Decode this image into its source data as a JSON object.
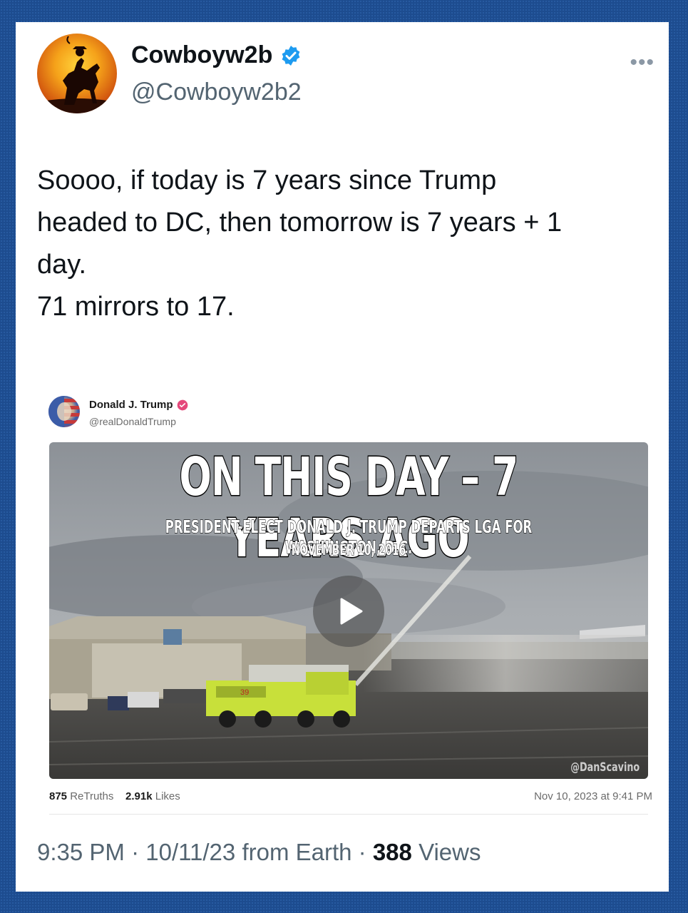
{
  "tweet": {
    "display_name": "Cowboyw2b",
    "handle": "@Cowboyw2b2",
    "more_label": "•••",
    "text_lines": [
      "Soooo, if today is 7 years since Trump",
      "headed to DC, then tomorrow is 7 years + 1",
      "day.",
      "71 mirrors to 17."
    ],
    "time": "9:35 PM",
    "date": "10/11/23",
    "source": "from Earth",
    "views_count": "388",
    "views_label": "Views",
    "separator": "·"
  },
  "embedded_post": {
    "display_name": "Donald J. Trump",
    "handle": "@realDonaldTrump",
    "video": {
      "headline": "ON THIS DAY – 7 YEARS AGO",
      "subheadline": "PRESIDENT-ELECT DONALD J. TRUMP DEPARTS LGA FOR WASHINGTON, D.C.",
      "date_caption": "NOVEMBER 10, 2016",
      "credit": "@DanScavino",
      "truck_number": "39"
    },
    "retruths_count": "875",
    "retruths_label": "ReTruths",
    "likes_count": "2.91k",
    "likes_label": "Likes",
    "posted_at": "Nov 10, 2023 at 9:41 PM"
  },
  "colors": {
    "background": "#1d4c8f",
    "verified_blue": "#1d9bf0",
    "truth_verified": "#e5487b",
    "text_primary": "#0f1419",
    "text_secondary": "#536471"
  }
}
